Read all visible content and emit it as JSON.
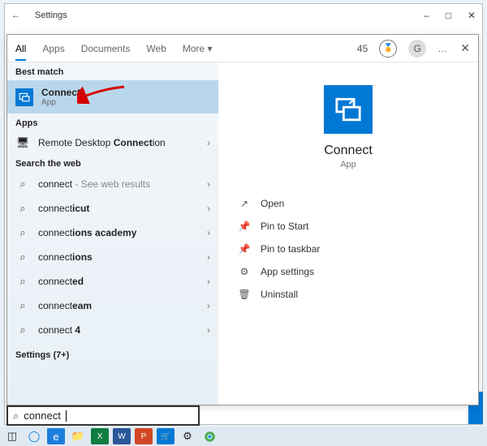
{
  "settings_window": {
    "title": "Settings"
  },
  "tabs": {
    "all": "All",
    "apps": "Apps",
    "documents": "Documents",
    "web": "Web",
    "more": "More",
    "points": "45",
    "avatar_initial": "G"
  },
  "left": {
    "best_match_label": "Best match",
    "best_match": {
      "title": "Connect",
      "kind": "App"
    },
    "apps_label": "Apps",
    "apps": [
      {
        "prefix": "Remote Desktop ",
        "bold": "Connect",
        "suffix": "ion"
      }
    ],
    "web_label": "Search the web",
    "web": [
      {
        "boldPrefix": "connect",
        "rest": "",
        "hint": " - See web results"
      },
      {
        "boldPrefix": "connect",
        "rest": "icut",
        "hint": ""
      },
      {
        "boldPrefix": "connect",
        "rest": "ions academy",
        "hint": ""
      },
      {
        "boldPrefix": "connect",
        "rest": "ions",
        "hint": ""
      },
      {
        "boldPrefix": "connect",
        "rest": "ed",
        "hint": ""
      },
      {
        "boldPrefix": "connect",
        "rest": "eam",
        "hint": ""
      },
      {
        "boldPrefix": "connect",
        "rest": " 4",
        "hint": ""
      }
    ],
    "settings_label": "Settings (7+)"
  },
  "right": {
    "app_name": "Connect",
    "app_kind": "App",
    "actions": {
      "open": "Open",
      "pin_start": "Pin to Start",
      "pin_taskbar": "Pin to taskbar",
      "settings": "App settings",
      "uninstall": "Uninstall"
    }
  },
  "search": {
    "value": "connect"
  }
}
